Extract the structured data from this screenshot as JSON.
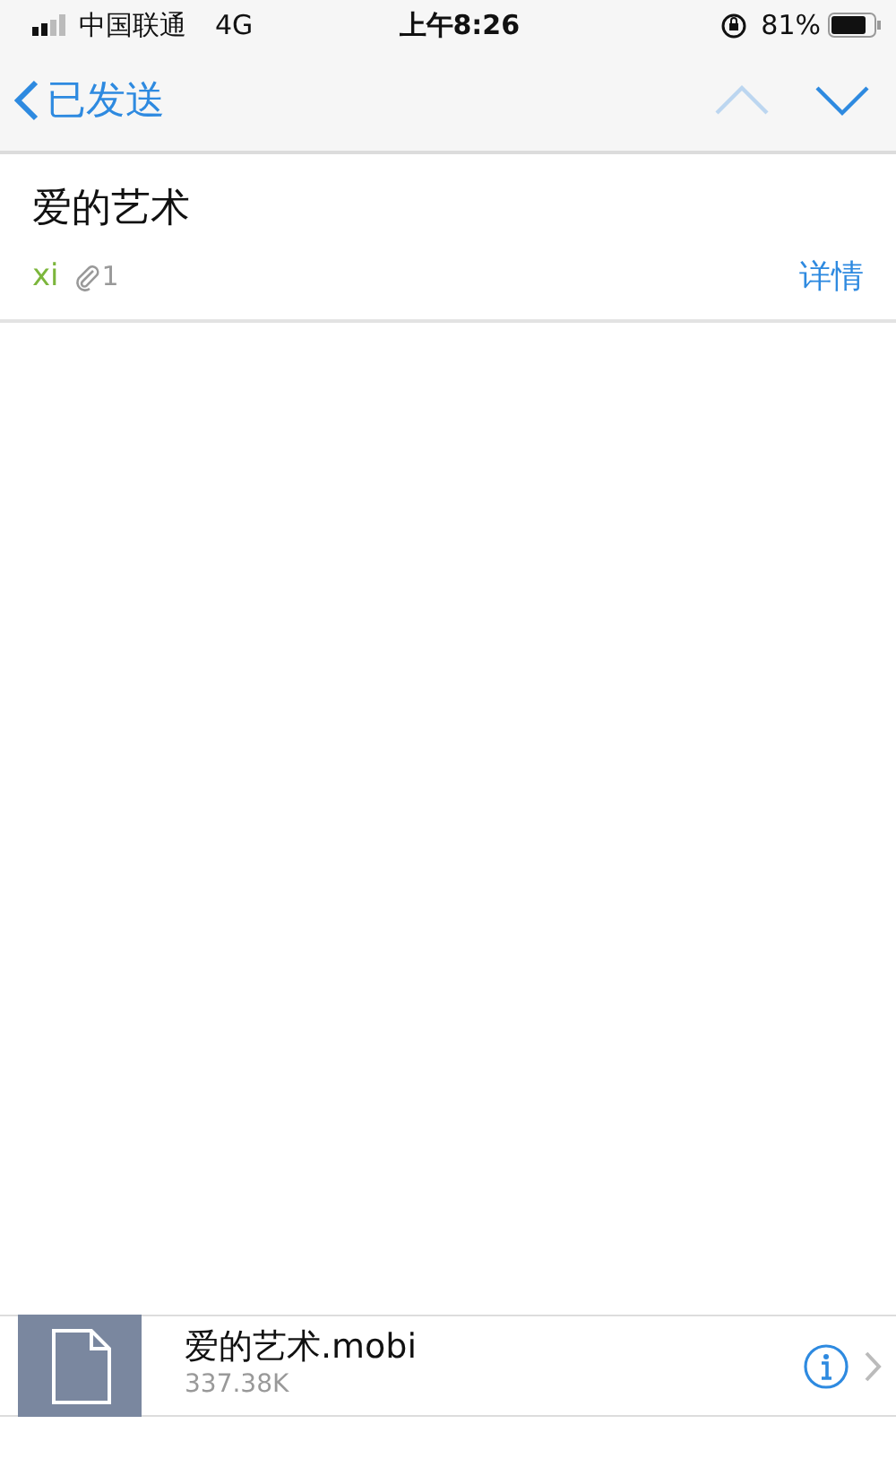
{
  "status_bar": {
    "carrier": "中国联通",
    "network": "4G",
    "time": "上午8:26",
    "battery": "81%"
  },
  "nav_bar": {
    "back_label": "已发送",
    "arrows": [
      {
        "kind": "up",
        "disabled": true
      },
      {
        "kind": "down",
        "disabled": false
      }
    ]
  },
  "message": {
    "subject": "爱的艺术",
    "sender": "xi",
    "attachment_count": "1",
    "details_link": "详情"
  },
  "attachment": {
    "file_name": "爱的艺术.mobi",
    "size": "337.38K"
  }
}
